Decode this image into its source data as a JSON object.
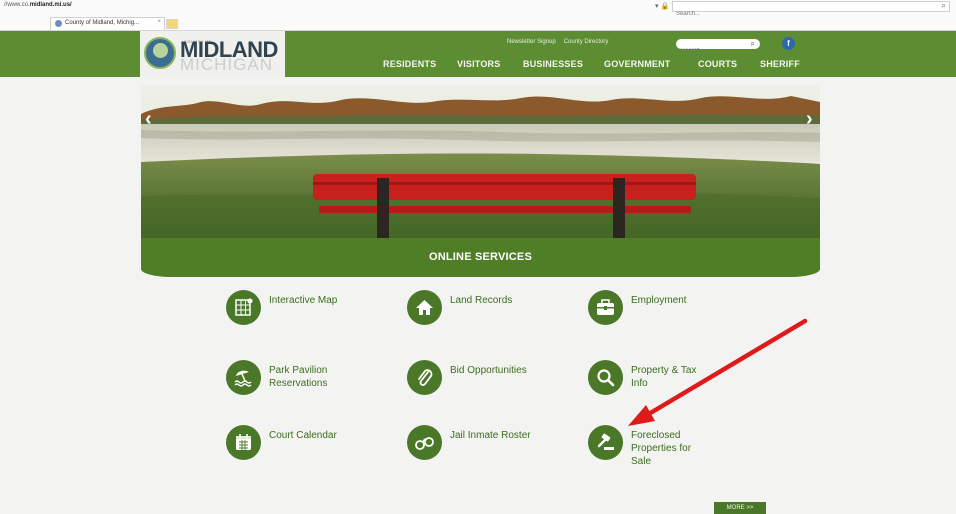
{
  "browser": {
    "url_prefix": "//www.co.",
    "url_domain": "midland.mi.us/",
    "search_placeholder": "Search...",
    "tab_title": "County of Midland, Michig...",
    "tab_close": "×"
  },
  "header": {
    "county_of": "COUNTY OF",
    "logo_line1": "MIDLAND",
    "logo_line2": "MICHIGAN",
    "utility_links": [
      "Newsletter Signup",
      "County Directory"
    ],
    "search_placeholder": "Search...",
    "facebook": "f",
    "nav": [
      "RESIDENTS",
      "VISITORS",
      "BUSINESSES",
      "GOVERNMENT",
      "COURTS",
      "SHERIFF"
    ]
  },
  "hero": {
    "prev": "‹",
    "next": "›"
  },
  "online_services": {
    "title": "ONLINE SERVICES",
    "items": [
      {
        "label": "Interactive Map",
        "icon": "map-icon"
      },
      {
        "label": "Land Records",
        "icon": "home-icon"
      },
      {
        "label": "Employment",
        "icon": "briefcase-icon"
      },
      {
        "label": "Park Pavilion Reservations",
        "icon": "beach-umbrella-icon"
      },
      {
        "label": "Bid Opportunities",
        "icon": "paperclip-icon"
      },
      {
        "label": "Property & Tax Info",
        "icon": "search-icon"
      },
      {
        "label": "Court Calendar",
        "icon": "calendar-icon"
      },
      {
        "label": "Jail Inmate Roster",
        "icon": "handcuffs-icon"
      },
      {
        "label": "Foreclosed Properties for Sale",
        "icon": "gavel-icon"
      }
    ],
    "more": "MORE >>"
  },
  "colors": {
    "header_green": "#5d8d33",
    "icon_green": "#4b7828",
    "link_green": "#3d6d20",
    "annotation_red": "#e0191b"
  }
}
